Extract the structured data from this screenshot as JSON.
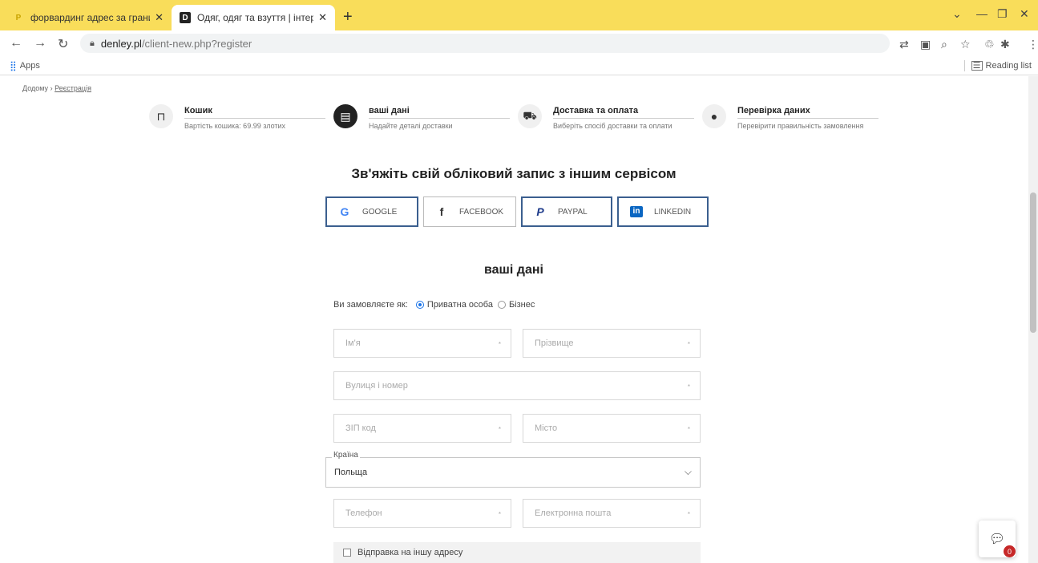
{
  "browser": {
    "tabs": [
      {
        "title": "форвардинг адрес за границей",
        "favicon": "Р"
      },
      {
        "title": "Одяг, одяг та взуття | інтернет-",
        "favicon": "D"
      }
    ],
    "url_domain": "denley.pl",
    "url_path": "/client-new.php?register",
    "bookmarks": {
      "apps": "Apps",
      "reading_list": "Reading list"
    },
    "accent": "#f9dd5a"
  },
  "breadcrumb": {
    "home": "Додому",
    "separator": "›",
    "current": "Реєстрація"
  },
  "steps": [
    {
      "title": "Кошик",
      "subtitle": "Вартість кошика: 69.99 злотих",
      "icon": "bag-icon"
    },
    {
      "title": "ваші дані",
      "subtitle": "Надайте деталі доставки",
      "icon": "document-icon"
    },
    {
      "title": "Доставка та оплата",
      "subtitle": "Виберіть спосіб доставки та оплати",
      "icon": "truck-icon"
    },
    {
      "title": "Перевірка даних",
      "subtitle": "Перевірити правильність замовлення",
      "icon": "chat-bubble-icon"
    }
  ],
  "social_heading": "Зв'яжіть свій обліковий запис з іншим сервісом",
  "social_buttons": [
    {
      "label": "GOOGLE",
      "icon": "G"
    },
    {
      "label": "FACEBOOK",
      "icon": "f"
    },
    {
      "label": "PAYPAL",
      "icon": "P"
    },
    {
      "label": "LINKEDIN",
      "icon": "in"
    }
  ],
  "form_heading": "ваші дані",
  "order_type": {
    "label": "Ви замовляєте як:",
    "private": "Приватна особа",
    "business": "Бізнес",
    "selected": "private"
  },
  "fields": {
    "first_name": "Ім'я",
    "last_name": "Прізвище",
    "street": "Вулиця і номер",
    "zip": "ЗІП код",
    "city": "Місто",
    "phone": "Телефон",
    "email": "Електронна пошта",
    "required_mark": "*"
  },
  "country": {
    "label": "Країна",
    "value": "Польща"
  },
  "ship_other": "Відправка на іншу адресу",
  "chat": {
    "badge": "0"
  }
}
